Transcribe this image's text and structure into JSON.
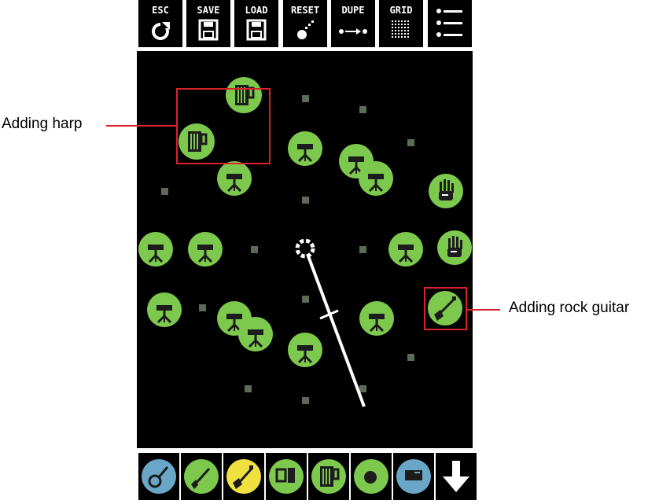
{
  "toolbar": {
    "buttons": [
      {
        "label": "ESC",
        "icon": "refresh-icon"
      },
      {
        "label": "SAVE",
        "icon": "floppy-save-icon"
      },
      {
        "label": "LOAD",
        "icon": "floppy-load-icon"
      },
      {
        "label": "RESET",
        "icon": "bomb-icon"
      },
      {
        "label": "DUPE",
        "icon": "duplicate-arrow-icon"
      },
      {
        "label": "GRID",
        "icon": "grid-icon"
      },
      {
        "label": "",
        "icon": "menu-list-icon"
      }
    ]
  },
  "annotations": {
    "left_label": "Adding harp",
    "right_label": "Adding rock guitar",
    "accent_color": "#d8232a"
  },
  "colors": {
    "node_green": "#7dc94e",
    "node_dark": "#1c1c1c",
    "grid_dot": "#5b6b55",
    "canvas_bg": "#000000"
  },
  "bottom_palette": [
    {
      "icon": "banjo-icon",
      "color": "#6aa6c8"
    },
    {
      "icon": "guitar-icon",
      "color": "#7dc94e"
    },
    {
      "icon": "rock-guitar-icon",
      "color": "#f0e140"
    },
    {
      "icon": "keyboard-icon",
      "color": "#7dc94e"
    },
    {
      "icon": "harp-icon",
      "color": "#7dc94e"
    },
    {
      "icon": "drum-icon",
      "color": "#7dc94e"
    },
    {
      "icon": "speaker-icon",
      "color": "#6aa6c8"
    },
    {
      "icon": "down-arrow-icon",
      "color": "#ffffff"
    }
  ]
}
